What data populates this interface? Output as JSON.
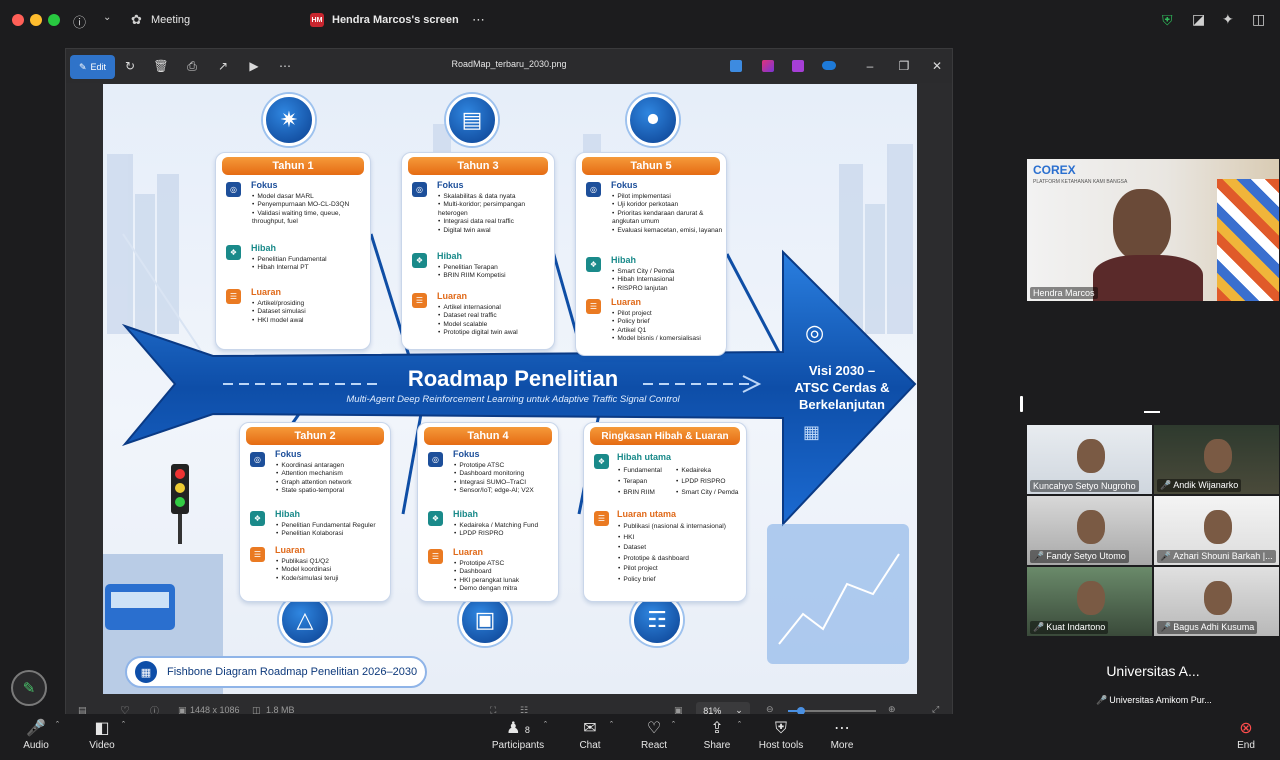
{
  "app": {
    "meeting_label": "Meeting",
    "shared_screen_title": "Hendra Marcos's screen",
    "presenter_initials": "HM"
  },
  "viewer": {
    "edit_label": "Edit",
    "filename": "RoadMap_terbaru_2030.png",
    "image_dimensions": "1448 x 1086",
    "file_size": "1.8 MB",
    "zoom": "81%"
  },
  "roadmap": {
    "title": "Roadmap Penelitian",
    "subtitle": "Multi-Agent Deep Reinforcement Learning untuk Adaptive Traffic Signal Control",
    "vision": "Visi 2030 –\nATSC Cerdas &\nBerkelanjutan",
    "footer": "Fishbone Diagram Roadmap Penelitian 2026–2030",
    "labels": {
      "fokus": "Fokus",
      "hibah": "Hibah",
      "luaran": "Luaran"
    },
    "year1": {
      "title": "Tahun 1",
      "fokus": [
        "Model dasar MARL",
        "Penyempurnaan MO-CL-D3QN",
        "Validasi waiting time, queue, throughput, fuel"
      ],
      "hibah": [
        "Penelitian Fundamental",
        "Hibah Internal PT"
      ],
      "luaran": [
        "Artikel/prosiding",
        "Dataset simulasi",
        "HKI model awal"
      ]
    },
    "year3": {
      "title": "Tahun 3",
      "fokus": [
        "Skalabilitas & data nyata",
        "Multi-koridor; persimpangan heterogen",
        "Integrasi data real traffic",
        "Digital twin awal"
      ],
      "hibah": [
        "Penelitian Terapan",
        "BRIN RIIM Kompetisi"
      ],
      "luaran": [
        "Artikel internasional",
        "Dataset real traffic",
        "Model scalable",
        "Prototipe digital twin awal"
      ]
    },
    "year5": {
      "title": "Tahun 5",
      "fokus": [
        "Pilot implementasi",
        "Uji koridor perkotaan",
        "Prioritas kendaraan darurat & angkutan umum",
        "Evaluasi kemacetan, emisi, layanan"
      ],
      "hibah": [
        "Smart City / Pemda",
        "Hibah Internasional",
        "RISPRO lanjutan"
      ],
      "luaran": [
        "Pilot project",
        "Policy brief",
        "Artikel Q1",
        "Model bisnis / komersialisasi"
      ]
    },
    "year2": {
      "title": "Tahun 2",
      "fokus": [
        "Koordinasi antaragen",
        "Attention mechanism",
        "Graph attention network",
        "State spatio-temporal"
      ],
      "hibah": [
        "Penelitian Fundamental Reguler",
        "Penelitian Kolaborasi"
      ],
      "luaran": [
        "Publikasi Q1/Q2",
        "Model koordinasi",
        "Kode/simulasi teruji"
      ]
    },
    "year4": {
      "title": "Tahun 4",
      "fokus": [
        "Prototipe ATSC",
        "Dashboard monitoring",
        "Integrasi SUMO–TraCI",
        "Sensor/IoT; edge-AI; V2X"
      ],
      "hibah": [
        "Kedaireka / Matching Fund",
        "LPDP RISPRO"
      ],
      "luaran": [
        "Prototipe ATSC",
        "Dashboard",
        "HKI perangkat lunak",
        "Demo dengan mitra"
      ]
    },
    "summary": {
      "title": "Ringkasan Hibah & Luaran",
      "hibah_title": "Hibah utama",
      "hibah_col1": [
        "Fundamental",
        "Terapan",
        "BRIN RIIM"
      ],
      "hibah_col2": [
        "Kedaireka",
        "LPDP RISPRO",
        "Smart City / Pemda"
      ],
      "luaran_title": "Luaran utama",
      "luaran": [
        "Publikasi (nasional & internasional)",
        "HKI",
        "Dataset",
        "Prototipe & dashboard",
        "Pilot project",
        "Policy brief"
      ]
    }
  },
  "participants": {
    "speaker": {
      "name": "Hendra Marcos",
      "logo_text": "COREX",
      "logo_sub": "PLATFORM KETAHANAN KAMI BANGSA"
    },
    "tiles": [
      {
        "name": "Kuncahyo Setyo Nugroho",
        "muted": false
      },
      {
        "name": "Andik Wijanarko",
        "muted": true
      },
      {
        "name": "Fandy Setyo Utomo",
        "muted": true
      },
      {
        "name": "Azhari Shouni Barkah |...",
        "muted": true
      },
      {
        "name": "Kuat Indartono",
        "muted": true
      },
      {
        "name": "Bagus Adhi Kusuma",
        "muted": true
      }
    ],
    "text_tile": {
      "big": "Universitas A...",
      "name": "Universitas Amikom Pur..."
    }
  },
  "toolbar": {
    "audio": "Audio",
    "video": "Video",
    "participants": "Participants",
    "participants_count": "8",
    "chat": "Chat",
    "react": "React",
    "share": "Share",
    "host_tools": "Host tools",
    "more": "More",
    "end": "End"
  },
  "colors": {
    "accent": "#2f73c9",
    "orange": "#e56b13",
    "navy": "#0b3f8f",
    "end": "#e02828"
  }
}
